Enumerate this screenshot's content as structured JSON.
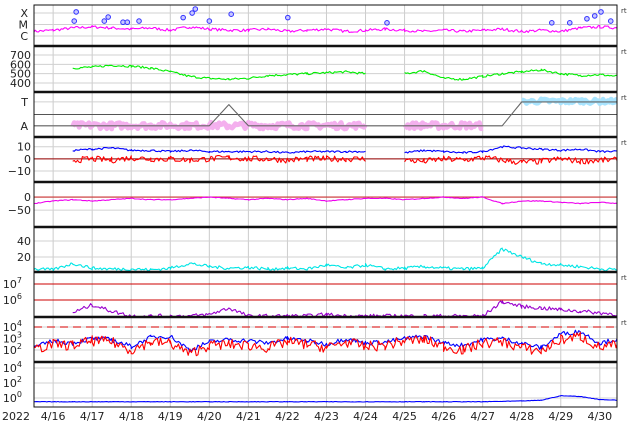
{
  "chart_data": {
    "type": "line",
    "title": "",
    "x_range_days": [
      15.51,
      30.44
    ],
    "x_year_label": "2022",
    "x_tick_labels": [
      "4/16",
      "4/17",
      "4/18",
      "4/19",
      "4/20",
      "4/21",
      "4/22",
      "4/23",
      "4/24",
      "4/25",
      "4/26",
      "4/27",
      "4/28",
      "4/29",
      "4/30"
    ],
    "t0": 15.5,
    "dt": 0.5,
    "panels": [
      {
        "id": "xray",
        "ylim": [
          -6.87,
          -3.3
        ],
        "ticks": [
          {
            "v": -4,
            "label": "X"
          },
          {
            "v": -5,
            "label": "M"
          },
          {
            "v": -6,
            "label": "C"
          }
        ],
        "rt_label": "rt",
        "series": [
          {
            "name": "xray-flux",
            "color": "#ff00ff",
            "noise": 0.12,
            "values": [
              -5.6,
              -5.5,
              -5.3,
              -5.2,
              -5.3,
              -5.4,
              -5.3,
              -5.5,
              -5.2,
              -5.4,
              -5.5,
              -5.5,
              -5.4,
              -5.6,
              -5.5,
              -5.4,
              -5.6,
              -5.5,
              -5.4,
              -5.5,
              -5.6,
              -5.5,
              -5.6,
              -5.5,
              -5.4,
              -5.6,
              -5.5,
              -5.6,
              -5.3,
              -5.2,
              -5.3
            ]
          }
        ],
        "markers": {
          "color": "#3333ff",
          "t": [
            16.54,
            16.59,
            17.31,
            17.41,
            17.79,
            17.9,
            18.2,
            19.33,
            19.56,
            19.64,
            20.0,
            20.56,
            22.01,
            24.55,
            28.77,
            29.23,
            29.67,
            29.87,
            30.03,
            30.28
          ],
          "v": [
            -4.7,
            -3.9,
            -4.7,
            -4.35,
            -4.8,
            -4.8,
            -4.7,
            -4.4,
            -4.0,
            -3.65,
            -4.7,
            -4.1,
            -4.4,
            -4.85,
            -4.85,
            -4.85,
            -4.5,
            -4.25,
            -3.9,
            -4.7
          ]
        }
      },
      {
        "id": "wind-speed",
        "ylim": [
          304,
          796
        ],
        "ticks": [
          {
            "v": 700,
            "label": "700"
          },
          {
            "v": 600,
            "label": "600"
          },
          {
            "v": 500,
            "label": "500"
          },
          {
            "v": 400,
            "label": "400"
          }
        ],
        "rt_label": "rt",
        "series": [
          {
            "name": "speed",
            "color": "#00ee00",
            "noise": 12,
            "values": [
              620,
              null,
              560,
              570,
              590,
              580,
              560,
              520,
              470,
              450,
              440,
              450,
              480,
              490,
              500,
              510,
              520,
              500,
              null,
              500,
              530,
              450,
              440,
              470,
              500,
              520,
              540,
              500,
              480,
              490,
              470
            ]
          }
        ]
      },
      {
        "id": "sector",
        "ylim": [
          0,
          1
        ],
        "ticks": [
          {
            "v": 0.78,
            "label": "T"
          },
          {
            "v": 0.25,
            "label": "A"
          }
        ],
        "rt_label": "rt",
        "series": [
          {
            "name": "away",
            "color": "#f4b0ee",
            "noise": 0.07,
            "values": [
              0.28,
              null,
              0.25,
              0.26,
              0.25,
              0.26,
              0.25,
              0.26,
              0.25,
              0.26,
              0.25,
              0.26,
              0.25,
              0.26,
              0.25,
              0.26,
              0.25,
              0.26,
              null,
              0.25,
              0.26,
              0.25,
              0.26,
              0.25,
              null,
              null,
              null,
              null,
              null,
              null,
              null
            ]
          },
          {
            "name": "toward",
            "color": "#a8e4ff",
            "noise": 0.05,
            "values": [
              null,
              null,
              null,
              null,
              null,
              null,
              null,
              null,
              null,
              null,
              null,
              null,
              null,
              null,
              null,
              null,
              null,
              null,
              null,
              null,
              null,
              null,
              null,
              null,
              null,
              0.78,
              0.8,
              0.79,
              0.8,
              0.79,
              0.8
            ]
          },
          {
            "name": "sector-line",
            "color": "#666666",
            "noise": 0,
            "values": [
              0.25,
              0.25,
              0.25,
              0.25,
              0.25,
              0.25,
              0.25,
              0.25,
              0.25,
              0.25,
              0.72,
              0.25,
              0.25,
              0.25,
              0.25,
              0.25,
              0.25,
              0.25,
              0.25,
              0.25,
              0.25,
              0.25,
              0.25,
              0.25,
              0.25,
              0.78,
              0.78,
              0.78,
              0.78,
              0.78,
              0.78
            ]
          }
        ]
      },
      {
        "id": "imf",
        "ylim": [
          -19,
          18
        ],
        "ticks": [
          {
            "v": 10,
            "label": "10"
          },
          {
            "v": 0,
            "label": "0"
          },
          {
            "v": -10,
            "label": "−10"
          }
        ],
        "rt_label": "rt",
        "series": [
          {
            "name": "Bt",
            "color": "#0000ff",
            "noise": 0.8,
            "values": [
              7,
              null,
              7,
              8,
              9,
              7,
              7,
              6,
              7,
              6,
              6,
              6,
              6,
              5,
              6,
              6,
              6,
              6,
              null,
              5,
              7,
              6,
              5,
              6,
              10,
              9,
              8,
              7,
              8,
              6,
              6
            ]
          },
          {
            "name": "Bz",
            "color": "#ff0000",
            "noise": 2.5,
            "values": [
              3,
              null,
              -1,
              0,
              -1,
              1,
              0,
              0,
              -1,
              0,
              1,
              0,
              0,
              -1,
              0,
              0,
              0,
              0,
              null,
              -1,
              -2,
              0,
              -1,
              1,
              -1,
              -3,
              -2,
              0,
              -2,
              -1,
              -1
            ]
          }
        ]
      },
      {
        "id": "dst",
        "ylim": [
          -115,
          58
        ],
        "ticks": [
          {
            "v": 0,
            "label": "0"
          },
          {
            "v": -50,
            "label": "−50"
          }
        ],
        "rt_label": "",
        "series": [
          {
            "name": "dst",
            "color": "#ee00ee",
            "noise": 1.5,
            "values": [
              -25,
              -15,
              -10,
              -15,
              -10,
              -5,
              -10,
              -10,
              -5,
              0,
              -5,
              -10,
              -5,
              -10,
              -5,
              -15,
              -10,
              -5,
              -5,
              -10,
              -5,
              0,
              -5,
              0,
              -25,
              -15,
              -15,
              -20,
              -25,
              -20,
              -25
            ]
          }
        ]
      },
      {
        "id": "kp",
        "ylim": [
          1.25,
          57.5
        ],
        "ticks": [
          {
            "v": 40,
            "label": "40"
          },
          {
            "v": 20,
            "label": "20"
          }
        ],
        "rt_label": "",
        "series": [
          {
            "name": "cyan",
            "color": "#00e5e5",
            "noise": 2,
            "values": [
              5,
              4,
              12,
              6,
              5,
              5,
              4,
              6,
              12,
              8,
              6,
              7,
              5,
              6,
              5,
              10,
              6,
              10,
              5,
              6,
              8,
              6,
              5,
              6,
              30,
              20,
              12,
              10,
              8,
              5,
              4
            ]
          }
        ]
      },
      {
        "id": "protons",
        "ylim": [
          4.94,
          7.75
        ],
        "ticks": [
          {
            "v": 7,
            "label": "10",
            "sup": "7"
          },
          {
            "v": 6,
            "label": "10",
            "sup": "6"
          }
        ],
        "rt_label": "rt",
        "series": [
          {
            "name": "purple",
            "color": "#9900cc",
            "noise": 0.12,
            "values": [
              null,
              null,
              5.2,
              5.7,
              5.3,
              5.0,
              5.0,
              5.0,
              5.0,
              5.1,
              5.5,
              5.0,
              5.0,
              5.0,
              5.0,
              5.1,
              5.0,
              5.0,
              5.0,
              5.0,
              5.0,
              5.0,
              5.0,
              5.0,
              5.9,
              5.6,
              5.5,
              5.4,
              5.3,
              5.2,
              5.1
            ]
          }
        ]
      },
      {
        "id": "electrons",
        "ylim": [
          0.96,
          4.87
        ],
        "ticks": [
          {
            "v": 4,
            "label": "10",
            "sup": "4"
          },
          {
            "v": 3,
            "label": "10",
            "sup": "3"
          },
          {
            "v": 2,
            "label": "10",
            "sup": "2"
          }
        ],
        "rt_label": "rt",
        "series": [
          {
            "name": "blue",
            "color": "#0000ff",
            "noise": 0.2,
            "values": [
              2.2,
              2.8,
              2.6,
              3.0,
              2.9,
              2.3,
              3.1,
              3.2,
              2.0,
              2.7,
              2.9,
              2.8,
              2.6,
              3.0,
              2.8,
              2.5,
              3.0,
              2.6,
              2.7,
              3.0,
              3.2,
              2.6,
              2.4,
              2.9,
              3.0,
              2.6,
              2.2,
              3.4,
              3.6,
              2.6,
              3.0
            ]
          },
          {
            "name": "red",
            "color": "#ff0000",
            "noise": 0.45,
            "values": [
              2.0,
              2.5,
              2.4,
              2.8,
              2.7,
              2.0,
              2.7,
              2.6,
              1.7,
              2.4,
              2.5,
              2.4,
              2.2,
              2.7,
              2.5,
              2.2,
              2.7,
              2.3,
              2.4,
              2.8,
              2.9,
              2.3,
              2.0,
              2.6,
              2.7,
              2.2,
              1.9,
              2.9,
              3.2,
              2.2,
              2.5
            ]
          }
        ]
      },
      {
        "id": "bottom",
        "ylim": [
          -1.2,
          4.8
        ],
        "ticks": [
          {
            "v": 4,
            "label": "10",
            "sup": "4"
          },
          {
            "v": 2,
            "label": "10",
            "sup": "2"
          },
          {
            "v": 0,
            "label": "10",
            "sup": "0"
          }
        ],
        "rt_label": "",
        "series": [
          {
            "name": "blue",
            "color": "#0000ff",
            "noise": 0.03,
            "values": [
              -0.5,
              -0.5,
              -0.5,
              -0.5,
              -0.5,
              -0.5,
              -0.5,
              -0.5,
              -0.5,
              -0.5,
              -0.5,
              -0.5,
              -0.5,
              -0.5,
              -0.5,
              -0.5,
              -0.5,
              -0.5,
              -0.5,
              -0.5,
              -0.5,
              -0.5,
              -0.5,
              -0.5,
              -0.45,
              -0.4,
              -0.3,
              0.3,
              0.2,
              -0.2,
              -0.3
            ]
          }
        ]
      }
    ],
    "reference_lines": {
      "dst": [
        0
      ],
      "protons": [
        6,
        7
      ],
      "electrons_dashed": [
        4
      ]
    }
  }
}
